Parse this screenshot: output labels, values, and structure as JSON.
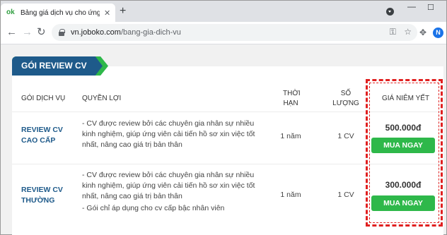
{
  "browser": {
    "tab_title": "Bảng giá dịch vụ cho ứng viên -",
    "tab_favicon": "ok",
    "url_host": "vn.joboko.com",
    "url_path": "/bang-gia-dich-vu",
    "avatar_letter": "N"
  },
  "section": {
    "title": "GÓI REVIEW CV"
  },
  "table": {
    "headers": {
      "service": "GÓI DỊCH VỤ",
      "benefit": "QUYỀN LỢI",
      "duration_line1": "THỜI",
      "duration_line2": "HẠN",
      "qty_line1": "SỐ",
      "qty_line2": "LƯỢNG",
      "price": "GIÁ NIÊM YẾT"
    },
    "rows": [
      {
        "service_line1": "REVIEW CV",
        "service_line2": "CAO CẤP",
        "benefit_1": "- CV được review bởi các chuyên gia nhân sự nhiều kinh nghiệm, giúp ứng viên cải tiến hồ sơ xin việc tốt nhất, nâng cao giá trị bản thân",
        "duration": "1 năm",
        "quantity": "1 CV",
        "price": "500.000đ",
        "button": "MUA NGAY"
      },
      {
        "service_line1": "REVIEW CV",
        "service_line2": "THƯỜNG",
        "benefit_1": "- CV được review bởi các chuyên gia nhân sự nhiều kinh nghiệm, giúp ứng viên cải tiến hồ sơ xin việc tốt nhất, nâng cao giá trị bản thân",
        "benefit_2": "- Gói chỉ áp dụng cho cv cấp bậc nhân viên",
        "duration": "1 năm",
        "quantity": "1 CV",
        "price": "300.000đ",
        "button": "MUA NGAY"
      }
    ]
  },
  "colors": {
    "brand_blue": "#1e5a8a",
    "brand_green": "#2eb84a",
    "highlight_red": "#e02020"
  }
}
